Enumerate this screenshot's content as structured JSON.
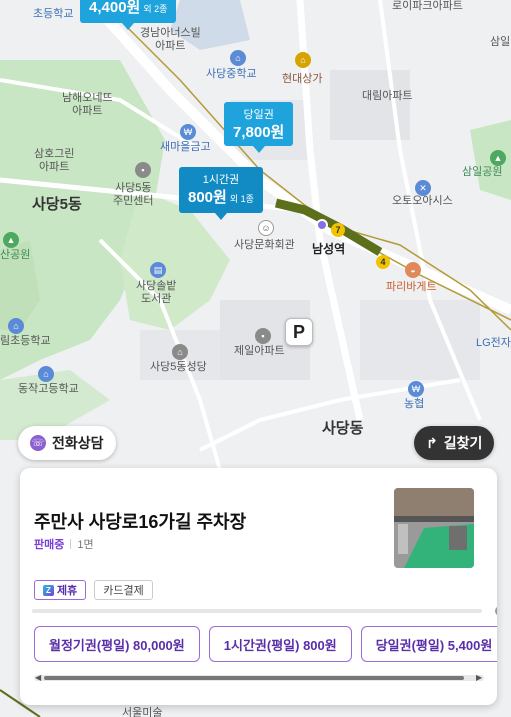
{
  "map": {
    "labels": {
      "school_top": "초등학교",
      "gyeongdang_apt": "경남아너스빌\n아파트",
      "sadang_middle": "사당중학교",
      "hyundai_mall": "현대상가",
      "royal_apt": "로이파크아파트",
      "samil": "삼일",
      "daerim_apt": "대림아파트",
      "namhae_apt": "남해오네뜨\n아파트",
      "saemaeul": "새마을금고",
      "samho_apt": "삼호그린\n아파트",
      "sadang5_center": "사당5동\n주민센터",
      "samil_park": "삼일공원",
      "sadang5": "사당5동",
      "otoo": "오토오아시스",
      "culture_hall": "사당문화회관",
      "namseong_station": "남성역",
      "park_mountain": "산공원",
      "solbat_library": "사당솔밭\n도서관",
      "paris": "파리바게트",
      "lg": "LG전자",
      "elementary": "림초등학교",
      "jeil_apt": "제일아파트",
      "sadang5_church": "사당5동성당",
      "dongjak_high": "동작고등학교",
      "nonghyup": "농협",
      "sadang_bottom": "사당동",
      "bottom_text": "서울미술"
    },
    "markers": [
      {
        "label": "",
        "price": "4,400원",
        "extra": "외 2종"
      },
      {
        "label": "당일권",
        "price": "7,800원",
        "extra": ""
      },
      {
        "label": "1시간권",
        "price": "800원",
        "extra": "외 1종"
      }
    ],
    "parking_marker": "P",
    "station_numbers": {
      "line7": "7",
      "line4": "4"
    }
  },
  "buttons": {
    "phone": "전화상담",
    "route": "길찾기"
  },
  "card": {
    "name": "주만사 사당로16가길 주차장",
    "status": "판매중",
    "spaces": "1면",
    "tags": {
      "partner": "제휴",
      "card": "카드결제"
    },
    "tickets": [
      "월정기권(평일) 80,000원",
      "1시간권(평일) 800원",
      "당일권(평일) 5,400원"
    ]
  },
  "colors": {
    "marker": "#1fa3dc",
    "marker_dark": "#128bc5",
    "accent": "#7b3fd6",
    "line4": "#2fa0db",
    "line7": "#5c6f1b"
  }
}
